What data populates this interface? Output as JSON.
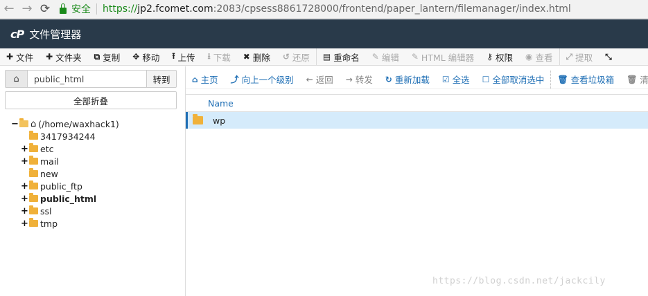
{
  "browser": {
    "secure_label": "安全",
    "url_scheme": "https://",
    "url_host": "jp2.fcomet.com",
    "url_rest": ":2083/cpsess8861728000/frontend/paper_lantern/filemanager/index.html"
  },
  "header": {
    "logo": "cP",
    "title": "文件管理器"
  },
  "toolbar": {
    "items": [
      {
        "icon": "plus-icon",
        "glyph": "✚",
        "label": "文件",
        "enabled": true
      },
      {
        "icon": "plus-icon",
        "glyph": "✚",
        "label": "文件夹",
        "enabled": true
      },
      {
        "icon": "copy-icon",
        "glyph": "⧉",
        "label": "复制",
        "enabled": true
      },
      {
        "icon": "move-icon",
        "glyph": "✥",
        "label": "移动",
        "enabled": true
      },
      {
        "icon": "upload-icon",
        "glyph": "⭱",
        "label": "上传",
        "enabled": true
      },
      {
        "icon": "download-icon",
        "glyph": "⭳",
        "label": "下载",
        "enabled": false
      },
      {
        "icon": "delete-icon",
        "glyph": "✖",
        "label": "删除",
        "enabled": true
      },
      {
        "icon": "restore-icon",
        "glyph": "↺",
        "label": "还原",
        "enabled": false
      },
      {
        "icon": "rename-icon",
        "glyph": "▤",
        "label": "重命名",
        "enabled": true
      },
      {
        "icon": "edit-icon",
        "glyph": "✎",
        "label": "编辑",
        "enabled": false
      },
      {
        "icon": "html-edit-icon",
        "glyph": "✎",
        "label": "HTML 编辑器",
        "enabled": false
      },
      {
        "icon": "key-icon",
        "glyph": "⚷",
        "label": "权限",
        "enabled": true
      },
      {
        "icon": "eye-icon",
        "glyph": "◉",
        "label": "查看",
        "enabled": false
      },
      {
        "icon": "extract-icon",
        "glyph": "⤢",
        "label": "提取",
        "enabled": false
      },
      {
        "icon": "compress-icon",
        "glyph": "⤡",
        "label": "",
        "enabled": true
      }
    ]
  },
  "left": {
    "home_icon": "home-icon",
    "path_value": "public_html",
    "go_label": "转到",
    "collapse_label": "全部折叠",
    "tree": {
      "root_label": "(/home/waxhack1)",
      "children": [
        {
          "label": "3417934244",
          "expandable": false,
          "bold": false
        },
        {
          "label": "etc",
          "expandable": true,
          "bold": false
        },
        {
          "label": "mail",
          "expandable": true,
          "bold": false
        },
        {
          "label": "new",
          "expandable": false,
          "bold": false
        },
        {
          "label": "public_ftp",
          "expandable": true,
          "bold": false
        },
        {
          "label": "public_html",
          "expandable": true,
          "bold": true
        },
        {
          "label": "ssl",
          "expandable": true,
          "bold": false
        },
        {
          "label": "tmp",
          "expandable": true,
          "bold": false
        }
      ]
    }
  },
  "right": {
    "toolbar": [
      {
        "icon": "home-icon",
        "glyph": "⌂",
        "label": "主页",
        "enabled": true
      },
      {
        "icon": "level-up-icon",
        "glyph": "⤴",
        "label": "向上一个级别",
        "enabled": true
      },
      {
        "icon": "back-icon",
        "glyph": "←",
        "label": "返回",
        "enabled": false
      },
      {
        "icon": "forward-icon",
        "glyph": "→",
        "label": "转发",
        "enabled": false
      },
      {
        "icon": "refresh-icon",
        "glyph": "↻",
        "label": "重新加载",
        "enabled": true
      },
      {
        "icon": "check-icon",
        "glyph": "☑",
        "label": "全选",
        "enabled": true
      },
      {
        "icon": "unchecked-icon",
        "glyph": "☐",
        "label": "全部取消选中",
        "enabled": true
      },
      {
        "icon": "trash-icon",
        "glyph": "🗑",
        "label": "查看垃圾箱",
        "enabled": true
      },
      {
        "icon": "trash-icon",
        "glyph": "🗑",
        "label": "清空",
        "enabled": false
      }
    ],
    "columns": [
      "Name"
    ],
    "rows": [
      {
        "name": "wp",
        "icon": "folder-icon"
      }
    ]
  },
  "watermark": "https://blog.csdn.net/jackcily",
  "colors": {
    "header_bg": "#293a4a",
    "link": "#1f6fb5",
    "selected_row": "#d5ebfb",
    "folder": "#f0b13a"
  }
}
